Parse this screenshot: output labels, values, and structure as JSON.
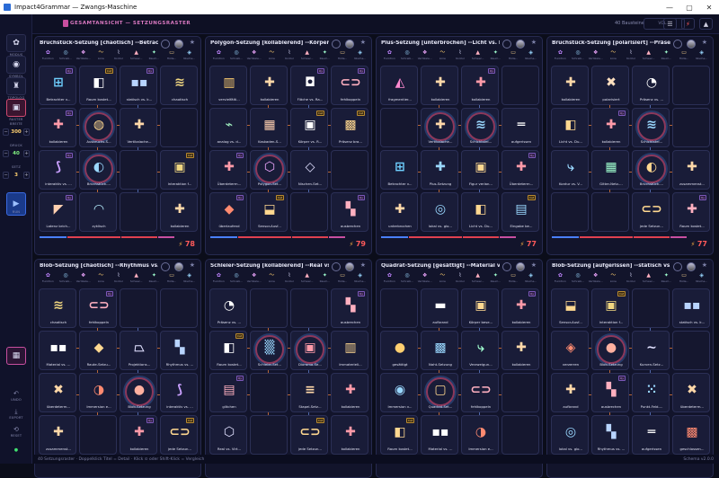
{
  "window": {
    "title": "Impact4Grammar — Zwangs-Maschine"
  },
  "toolbar": {
    "crumb": "GESAMTANSICHT — SETZUNGSRASTER",
    "count": "40 Bausteine",
    "pill": "VGL..."
  },
  "sidebar": {
    "items": [
      {
        "icon": "✿",
        "label": "MODUS"
      },
      {
        "icon": "◉",
        "label": "SYMBOL"
      },
      {
        "icon": "♜",
        "label": "TOPOLOG"
      },
      {
        "icon": "▣",
        "label": "RASTER"
      }
    ],
    "steppers": [
      {
        "label": "BREITE",
        "value": "300"
      },
      {
        "label": "DRUCK",
        "value": "40"
      },
      {
        "label": "SETZ",
        "value": "3"
      }
    ],
    "run_label": "RUN",
    "bottom_items": [
      "UNDO",
      "EXPORT",
      "RESET"
    ]
  },
  "status": {
    "text": "40 Setzungsraster · Doppelklick Titel = Detail · Klick ⊙ oder Shift-Klick = Vergleich",
    "version": "Schema v2.0.0"
  },
  "panels": [
    {
      "title": "Bruchstück-Setzung [chaotisch] --Betrachter ...",
      "score": "78",
      "cells": [
        {
          "label": "Betrachter v...",
          "glyph": "⊞",
          "color": "#6fd0ff",
          "badge": "Qy"
        },
        {
          "label": "Raum kostet...",
          "glyph": "◧",
          "color": "#ffffff",
          "badge": "Cat"
        },
        {
          "label": "statisch vs. k...",
          "glyph": "▪▪",
          "color": "#b8d4ff",
          "badge": "Qy"
        },
        {
          "label": "chaotisch",
          "glyph": "≋",
          "color": "#f0d680",
          "badge": ""
        },
        {
          "label": "kollabieren",
          "glyph": "✚",
          "color": "#ff9aa8",
          "badge": "Qy"
        },
        {
          "label": "Ausbruchs-S...",
          "glyph": "◍",
          "color": "#ffd890",
          "badge": "",
          "ring": true
        },
        {
          "label": "Vertikalache...",
          "glyph": "✚",
          "color": "#ffd8a8",
          "badge": ""
        },
        {
          "label": "",
          "glyph": "",
          "color": "#888",
          "badge": ""
        },
        {
          "label": "interaktiv vs. ...",
          "glyph": "⟆",
          "color": "#c9a0ff",
          "badge": "Qy"
        },
        {
          "label": "Bruchstück-...",
          "glyph": "◐",
          "color": "#9ad8ff",
          "badge": "",
          "ring": true
        },
        {
          "label": "",
          "glyph": "",
          "color": "#888",
          "badge": ""
        },
        {
          "label": "Interaktion f...",
          "glyph": "▣",
          "color": "#f0d680",
          "badge": "Cat"
        },
        {
          "label": "Latenz brich...",
          "glyph": "◤",
          "color": "#ffd0b0",
          "badge": "Qy"
        },
        {
          "label": "zyklisch",
          "glyph": "◠",
          "color": "#b8f0ff",
          "badge": ""
        },
        {
          "label": "",
          "glyph": "",
          "color": "#888",
          "badge": ""
        },
        {
          "label": "kollabieren",
          "glyph": "✚",
          "color": "#ffd8a8",
          "badge": ""
        }
      ]
    },
    {
      "title": "Polygon-Setzung [kollabierend] --Körper vs...",
      "score": "79",
      "cells": [
        {
          "label": "vervielfälti...",
          "glyph": "▥",
          "color": "#ffcf70",
          "badge": ""
        },
        {
          "label": "kollabieren",
          "glyph": "✚",
          "color": "#ffd8a8",
          "badge": ""
        },
        {
          "label": "Fläche vs. Ra...",
          "glyph": "◘",
          "color": "#ffffff",
          "badge": "Qy"
        },
        {
          "label": "fehlkoppeln",
          "glyph": "⊂⊃",
          "color": "#ffb0c0",
          "badge": "Qy"
        },
        {
          "label": "analog vs. d...",
          "glyph": "⌁",
          "color": "#a0f0c0",
          "badge": ""
        },
        {
          "label": "Kaskaden-S...",
          "glyph": "▦",
          "color": "#ffd0b0",
          "badge": ""
        },
        {
          "label": "Körper vs. R...",
          "glyph": "▣",
          "color": "#ffffff",
          "badge": "Cat"
        },
        {
          "label": "Präsenz bra...",
          "glyph": "▩",
          "color": "#ffd890",
          "badge": "Cat"
        },
        {
          "label": "Überdeterm...",
          "glyph": "✚",
          "color": "#ff9aa8",
          "badge": "Qy"
        },
        {
          "label": "Polygon-Set...",
          "glyph": "⬡",
          "color": "#f0a8ff",
          "badge": "",
          "ring": true
        },
        {
          "label": "Nischen-Set...",
          "glyph": "◇",
          "color": "#e0e0ff",
          "badge": ""
        },
        {
          "label": "",
          "glyph": "",
          "color": "#888",
          "badge": ""
        },
        {
          "label": "überlaufend",
          "glyph": "◆",
          "color": "#ff8a70",
          "badge": "Qy"
        },
        {
          "label": "Sensor-Ausf...",
          "glyph": "⬓",
          "color": "#ffd890",
          "badge": "Cat"
        },
        {
          "label": "",
          "glyph": "",
          "color": "#888",
          "badge": ""
        },
        {
          "label": "ausbrechen",
          "glyph": "▚",
          "color": "#ffb0c0",
          "badge": "Qy"
        }
      ]
    },
    {
      "title": "Plus-Setzung [unterbrochen] --Licht vs. Dun...",
      "score": "77",
      "cells": [
        {
          "label": "fragmentier...",
          "glyph": "◭",
          "color": "#ff8ad0",
          "badge": ""
        },
        {
          "label": "kollabieren",
          "glyph": "✚",
          "color": "#ffd8a8",
          "badge": ""
        },
        {
          "label": "kollabieren",
          "glyph": "✚",
          "color": "#ff9aa8",
          "badge": "Qy"
        },
        {
          "label": "",
          "glyph": "",
          "color": "#888",
          "badge": ""
        },
        {
          "label": "",
          "glyph": "",
          "color": "#888",
          "badge": ""
        },
        {
          "label": "Vertikalache...",
          "glyph": "✚",
          "color": "#ffd8a8",
          "badge": "",
          "ring": true
        },
        {
          "label": "Schichtstel...",
          "glyph": "≋",
          "color": "#9ad8ff",
          "badge": "",
          "ring": true
        },
        {
          "label": "aufgerissen",
          "glyph": "═",
          "color": "#ffffff",
          "badge": ""
        },
        {
          "label": "Betrachter v...",
          "glyph": "⊞",
          "color": "#6fd0ff",
          "badge": ""
        },
        {
          "label": "Plus-Setzung",
          "glyph": "✚",
          "color": "#9ad8ff",
          "badge": ""
        },
        {
          "label": "Figur verlan...",
          "glyph": "▣",
          "color": "#ffd890",
          "badge": ""
        },
        {
          "label": "Überdeterm...",
          "glyph": "✚",
          "color": "#ff9aa8",
          "badge": "Qy"
        },
        {
          "label": "unterbrochen",
          "glyph": "✚",
          "color": "#ffd8a8",
          "badge": ""
        },
        {
          "label": "lokal vs. glo...",
          "glyph": "◎",
          "color": "#9ad8ff",
          "badge": ""
        },
        {
          "label": "Licht vs. Du...",
          "glyph": "◧",
          "color": "#ffd890",
          "badge": ""
        },
        {
          "label": "Eingabe be...",
          "glyph": "▤",
          "color": "#9ad8ff",
          "badge": "Cat"
        }
      ]
    },
    {
      "title": "Bruchstück-Setzung [polarisiert] --Präsenz v...",
      "score": "77",
      "cells": [
        {
          "label": "kollabieren",
          "glyph": "✚",
          "color": "#ffd8a8",
          "badge": ""
        },
        {
          "label": "polarisiert",
          "glyph": "✖",
          "color": "#ffe0c0",
          "badge": ""
        },
        {
          "label": "Präsenz vs. ...",
          "glyph": "◔",
          "color": "#ffffff",
          "badge": ""
        },
        {
          "label": "",
          "glyph": "",
          "color": "#888",
          "badge": ""
        },
        {
          "label": "Licht vs. Du...",
          "glyph": "◧",
          "color": "#ffd890",
          "badge": ""
        },
        {
          "label": "kollabieren",
          "glyph": "✚",
          "color": "#ff9aa8",
          "badge": "Qy"
        },
        {
          "label": "Schichtstel...",
          "glyph": "≋",
          "color": "#9ad8ff",
          "badge": "",
          "ring": true
        },
        {
          "label": "",
          "glyph": "",
          "color": "#888",
          "badge": ""
        },
        {
          "label": "Kontur vs. V...",
          "glyph": "⤷",
          "color": "#9ad8ff",
          "badge": ""
        },
        {
          "label": "Gitter-Netz-...",
          "glyph": "▦",
          "color": "#a0ffd0",
          "badge": ""
        },
        {
          "label": "Bruchstück-...",
          "glyph": "◐",
          "color": "#ffd890",
          "badge": "",
          "ring": true
        },
        {
          "label": "zusammenst...",
          "glyph": "✚",
          "color": "#ffd8a8",
          "badge": ""
        },
        {
          "label": "",
          "glyph": "",
          "color": "#888",
          "badge": ""
        },
        {
          "label": "",
          "glyph": "",
          "color": "#888",
          "badge": ""
        },
        {
          "label": "jede Setzun...",
          "glyph": "⊂⊃",
          "color": "#ffd890",
          "badge": ""
        },
        {
          "label": "Raum kostet...",
          "glyph": "✚",
          "color": "#ffb0c0",
          "badge": "Qy"
        }
      ]
    },
    {
      "title": "Blob-Setzung [chaotisch] --Rhythmus vs. Ch...",
      "score": "",
      "cells": [
        {
          "label": "chaotisch",
          "glyph": "≋",
          "color": "#f0d680",
          "badge": ""
        },
        {
          "label": "fehlkoppeln",
          "glyph": "⊂⊃",
          "color": "#ffb0c0",
          "badge": "Qy"
        },
        {
          "label": "",
          "glyph": "",
          "color": "#888",
          "badge": ""
        },
        {
          "label": "",
          "glyph": "",
          "color": "#888",
          "badge": ""
        },
        {
          "label": "Material vs. ...",
          "glyph": "▪▪",
          "color": "#ffffff",
          "badge": ""
        },
        {
          "label": "Raute-Setzu...",
          "glyph": "◆",
          "color": "#ffd890",
          "badge": ""
        },
        {
          "label": "Projektions...",
          "glyph": "⏢",
          "color": "#e0e0ff",
          "badge": ""
        },
        {
          "label": "Rhythmus vs. ...",
          "glyph": "▚",
          "color": "#b8d4ff",
          "badge": ""
        },
        {
          "label": "überdeterm...",
          "glyph": "✖",
          "color": "#ffd8a8",
          "badge": ""
        },
        {
          "label": "Immersion e...",
          "glyph": "◑",
          "color": "#ff8a70",
          "badge": ""
        },
        {
          "label": "Blob-Setzung",
          "glyph": "●",
          "color": "#ffb0a0",
          "badge": "",
          "ring": true
        },
        {
          "label": "interaktiv vs. ...",
          "glyph": "⟆",
          "color": "#c9a0ff",
          "badge": ""
        },
        {
          "label": "zusammenst...",
          "glyph": "✚",
          "color": "#ffd8a8",
          "badge": ""
        },
        {
          "label": "",
          "glyph": "",
          "color": "#888",
          "badge": ""
        },
        {
          "label": "kollabieren",
          "glyph": "✚",
          "color": "#ff9aa8",
          "badge": "Qy"
        },
        {
          "label": "jede Setzun...",
          "glyph": "⊂⊃",
          "color": "#ffd890",
          "badge": "Cat"
        }
      ]
    },
    {
      "title": "Schleier-Setzung [kollabierend] --Real vs. Vir...",
      "score": "",
      "cells": [
        {
          "label": "Präsenz vs. ...",
          "glyph": "◔",
          "color": "#ffffff",
          "badge": ""
        },
        {
          "label": "",
          "glyph": "",
          "color": "#888",
          "badge": ""
        },
        {
          "label": "",
          "glyph": "",
          "color": "#888",
          "badge": ""
        },
        {
          "label": "ausbrechen",
          "glyph": "▚",
          "color": "#ffb0c0",
          "badge": "Qy"
        },
        {
          "label": "Raum kostet...",
          "glyph": "◧",
          "color": "#ffffff",
          "badge": "Cat"
        },
        {
          "label": "Schleier-Set...",
          "glyph": "▒",
          "color": "#9ad8ff",
          "badge": "",
          "ring": true
        },
        {
          "label": "Diorama-Se...",
          "glyph": "▣",
          "color": "#ff9aa8",
          "badge": "",
          "ring": true
        },
        {
          "label": "Immaterieli...",
          "glyph": "▥",
          "color": "#ffd890",
          "badge": ""
        },
        {
          "label": "glitchen",
          "glyph": "▤",
          "color": "#ffb0c0",
          "badge": "Qy"
        },
        {
          "label": "",
          "glyph": "",
          "color": "#888",
          "badge": ""
        },
        {
          "label": "Stapel-Setz...",
          "glyph": "≡",
          "color": "#ffd8a8",
          "badge": ""
        },
        {
          "label": "kollabieren",
          "glyph": "✚",
          "color": "#ff9aa8",
          "badge": ""
        },
        {
          "label": "Real vs. Virt...",
          "glyph": "⬡",
          "color": "#e0e0ff",
          "badge": ""
        },
        {
          "label": "",
          "glyph": "",
          "color": "#888",
          "badge": ""
        },
        {
          "label": "jede Setzun...",
          "glyph": "⊂⊃",
          "color": "#ffd890",
          "badge": "Cat"
        },
        {
          "label": "kollabieren",
          "glyph": "✚",
          "color": "#ff9aa8",
          "badge": ""
        }
      ]
    },
    {
      "title": "Quadrat-Setzung [gesättigt] --Material vs. I...",
      "score": "",
      "cells": [
        {
          "label": "",
          "glyph": "",
          "color": "#888",
          "badge": ""
        },
        {
          "label": "aufbrand",
          "glyph": "▬",
          "color": "#ffffff",
          "badge": ""
        },
        {
          "label": "Körper bese...",
          "glyph": "▣",
          "color": "#ffd890",
          "badge": ""
        },
        {
          "label": "kollabieren",
          "glyph": "✚",
          "color": "#ff9aa8",
          "badge": "Qy"
        },
        {
          "label": "gesättigt",
          "glyph": "●",
          "color": "#ffcf70",
          "badge": ""
        },
        {
          "label": "Naht-Setzung",
          "glyph": "▩",
          "color": "#9ad8ff",
          "badge": ""
        },
        {
          "label": "Verzweigun...",
          "glyph": "⤷",
          "color": "#a0ffd0",
          "badge": ""
        },
        {
          "label": "kollabieren",
          "glyph": "✚",
          "color": "#ffd8a8",
          "badge": ""
        },
        {
          "label": "Immersion v...",
          "glyph": "◉",
          "color": "#9ad8ff",
          "badge": ""
        },
        {
          "label": "Quadrat-Set...",
          "glyph": "▢",
          "color": "#ffd890",
          "badge": "",
          "ring": true
        },
        {
          "label": "fehlkoppeln",
          "glyph": "⊂⊃",
          "color": "#ffb0c0",
          "badge": ""
        },
        {
          "label": "",
          "glyph": "",
          "color": "#888",
          "badge": ""
        },
        {
          "label": "Raum kostet...",
          "glyph": "◧",
          "color": "#ffd890",
          "badge": "Cat"
        },
        {
          "label": "Material vs. ...",
          "glyph": "▪▪",
          "color": "#ffffff",
          "badge": ""
        },
        {
          "label": "Immersion e...",
          "glyph": "◑",
          "color": "#ff8a70",
          "badge": ""
        },
        {
          "label": "",
          "glyph": "",
          "color": "#888",
          "badge": ""
        }
      ]
    },
    {
      "title": "Blob-Setzung [aufgerissen] --statisch vs. kin...",
      "score": "",
      "cells": [
        {
          "label": "Sensor-Ausf...",
          "glyph": "⬓",
          "color": "#ffd890",
          "badge": ""
        },
        {
          "label": "Interaktion f...",
          "glyph": "▣",
          "color": "#f0d680",
          "badge": "Cat"
        },
        {
          "label": "",
          "glyph": "",
          "color": "#888",
          "badge": ""
        },
        {
          "label": "statisch vs. k...",
          "glyph": "▪▪",
          "color": "#b8d4ff",
          "badge": ""
        },
        {
          "label": "verzerren",
          "glyph": "◈",
          "color": "#ff8a70",
          "badge": ""
        },
        {
          "label": "Blob-Setzung",
          "glyph": "●",
          "color": "#ffb0a0",
          "badge": "",
          "ring": true
        },
        {
          "label": "Kurven-Setz...",
          "glyph": "∼",
          "color": "#e0e0ff",
          "badge": ""
        },
        {
          "label": "",
          "glyph": "",
          "color": "#888",
          "badge": ""
        },
        {
          "label": "aufbrand",
          "glyph": "✚",
          "color": "#ffd8a8",
          "badge": ""
        },
        {
          "label": "ausbrechen",
          "glyph": "▚",
          "color": "#ffb0c0",
          "badge": "Qy"
        },
        {
          "label": "Punkt-Feld-...",
          "glyph": "⁙",
          "color": "#9ad8ff",
          "badge": ""
        },
        {
          "label": "überdeterm...",
          "glyph": "✖",
          "color": "#ffd8a8",
          "badge": ""
        },
        {
          "label": "lokal vs. glo...",
          "glyph": "◎",
          "color": "#9ad8ff",
          "badge": ""
        },
        {
          "label": "Rhythmus vs. ...",
          "glyph": "▚",
          "color": "#b8d4ff",
          "badge": ""
        },
        {
          "label": "aufgerissen",
          "glyph": "═",
          "color": "#ffffff",
          "badge": ""
        },
        {
          "label": "geschlossen...",
          "glyph": "▩",
          "color": "#ff8a70",
          "badge": ""
        }
      ]
    }
  ],
  "panel_icon_labels": [
    "Funktion",
    "Schreib...",
    "Vertikale...",
    "Linie",
    "Kontur",
    "Schwer...",
    "Raum...",
    "Hülle...",
    "Nische..."
  ]
}
